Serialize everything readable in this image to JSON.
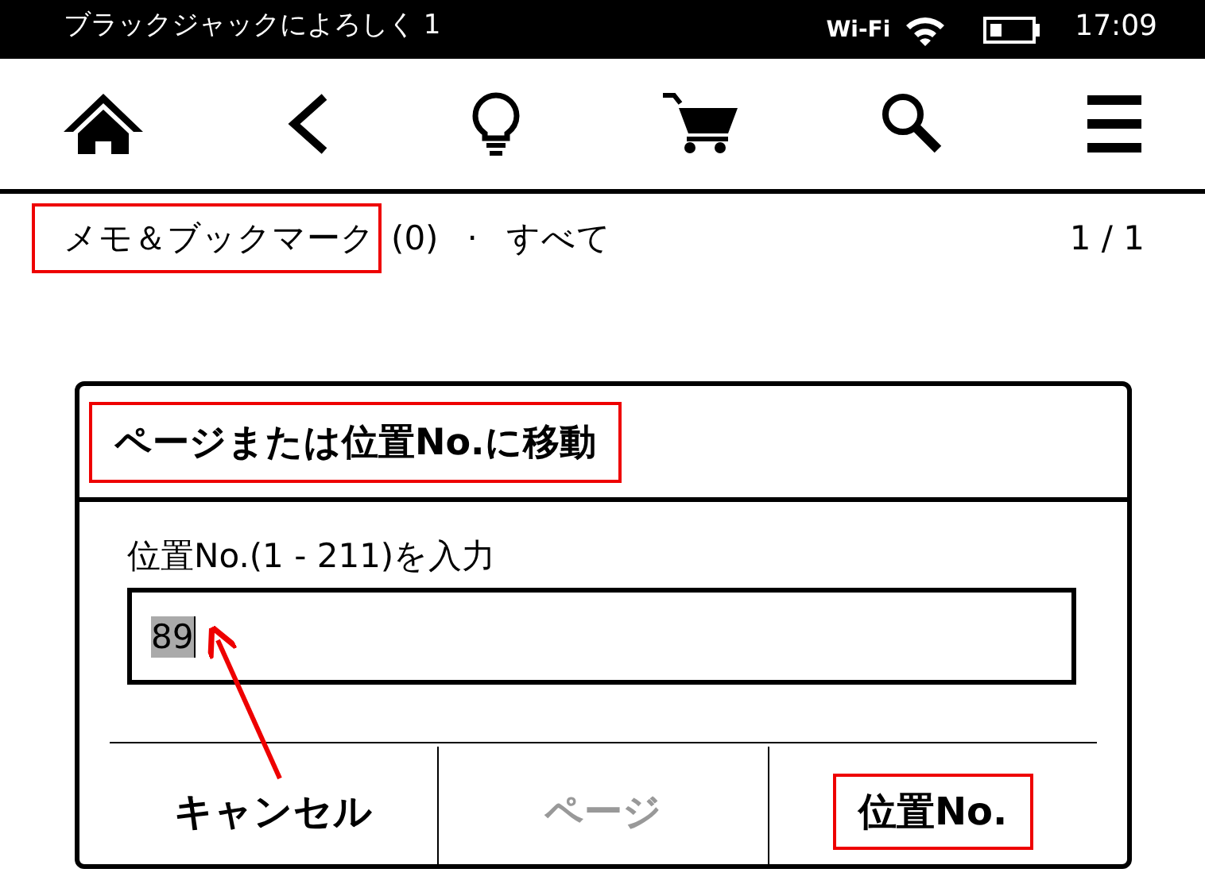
{
  "status_bar": {
    "book_title": "ブラックジャックによろしく 1",
    "wifi_label": "Wi-Fi",
    "time": "17:09"
  },
  "toolbar": {
    "items": [
      {
        "kind": "home"
      },
      {
        "kind": "back"
      },
      {
        "kind": "bulb"
      },
      {
        "kind": "cart"
      },
      {
        "kind": "search"
      },
      {
        "kind": "menu"
      }
    ]
  },
  "header": {
    "title": "メモ＆ブックマーク",
    "title_highlighted": true,
    "count": "(0)",
    "separator": "·",
    "filter": "すべて",
    "page": "1 / 1"
  },
  "dialog": {
    "title": "ページまたは位置No.に移動",
    "title_highlighted": true,
    "label": "位置No.(1 - 211)を入力",
    "value": "89",
    "value_selected": true,
    "annotation_arrow": true,
    "buttons": [
      {
        "label": "キャンセル",
        "disabled": false,
        "highlighted": false
      },
      {
        "label": "ページ",
        "disabled": true,
        "highlighted": false
      },
      {
        "label": "位置No.",
        "disabled": false,
        "highlighted": true
      }
    ]
  }
}
